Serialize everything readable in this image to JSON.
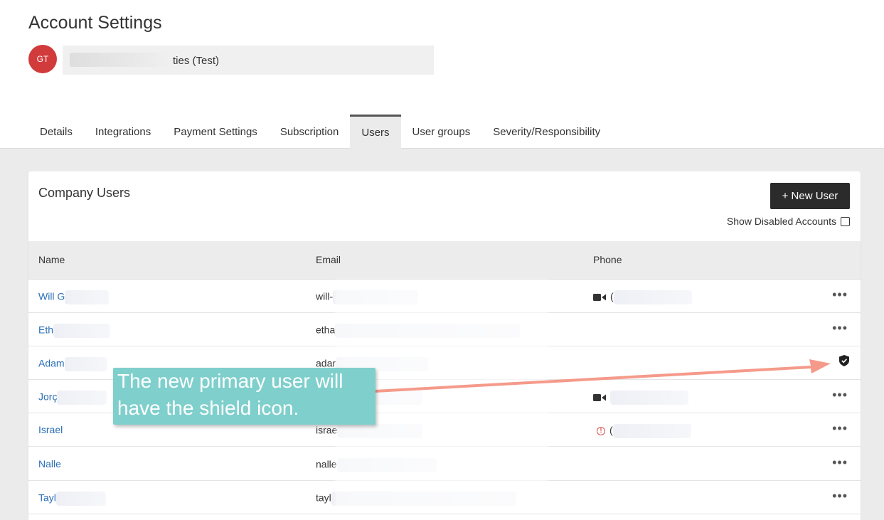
{
  "page": {
    "title": "Account Settings"
  },
  "account": {
    "avatar_initials": "GT",
    "name_visible_suffix": "ties (Test)"
  },
  "tabs": [
    {
      "label": "Details",
      "active": false
    },
    {
      "label": "Integrations",
      "active": false
    },
    {
      "label": "Payment Settings",
      "active": false
    },
    {
      "label": "Subscription",
      "active": false
    },
    {
      "label": "Users",
      "active": true
    },
    {
      "label": "User groups",
      "active": false
    },
    {
      "label": "Severity/Responsibility",
      "active": false
    }
  ],
  "users_card": {
    "title": "Company Users",
    "new_user_label": "+ New User",
    "show_disabled_label": "Show Disabled Accounts",
    "show_disabled_checked": false,
    "columns": {
      "name": "Name",
      "email": "Email",
      "phone": "Phone"
    },
    "rows": [
      {
        "name": "Will G",
        "email": "will-",
        "phone": "(",
        "phone_icon": "video-icon",
        "action_icon": "more-icon"
      },
      {
        "name": "Eth",
        "email": "etha",
        "phone": "",
        "phone_icon": "",
        "action_icon": "more-icon"
      },
      {
        "name": "Adam",
        "email": "adar",
        "phone": "",
        "phone_icon": "",
        "action_icon": "shield-icon"
      },
      {
        "name": "Jorç",
        "email": "",
        "phone": "",
        "phone_icon": "video-icon",
        "action_icon": "more-icon"
      },
      {
        "name": "Israel",
        "email": "israe",
        "phone": "(",
        "phone_icon": "warning-icon",
        "action_icon": "more-icon"
      },
      {
        "name": "Nalle",
        "email": "nalle",
        "phone": "",
        "phone_icon": "",
        "action_icon": "more-icon"
      },
      {
        "name": "Tayl",
        "email": "tayl",
        "phone": "",
        "phone_icon": "",
        "action_icon": "more-icon"
      }
    ]
  },
  "callout": {
    "line1": "The new primary user will",
    "line2": "have the shield icon."
  },
  "colors": {
    "link": "#2a6fb5",
    "avatar": "#d13b3b",
    "callout": "#7fcfcc",
    "arrow": "#f59a8a",
    "button": "#2b2b2b"
  }
}
